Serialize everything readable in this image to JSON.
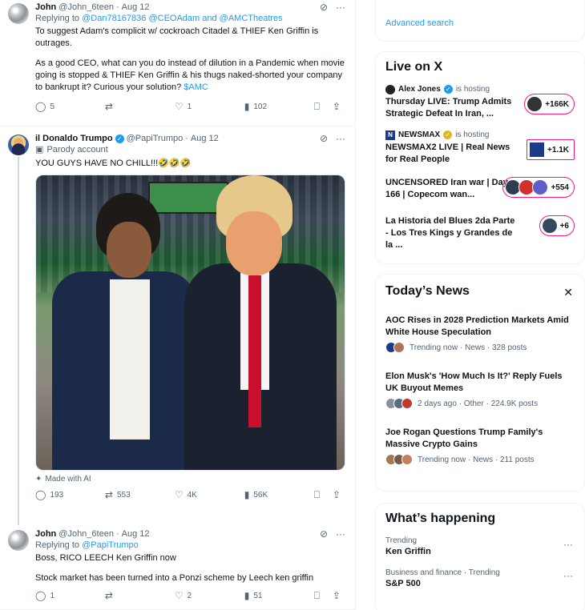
{
  "feed": {
    "tweets": [
      {
        "name": "John",
        "handle": "@John_6teen",
        "dot": "·",
        "date": "Aug 12",
        "replying_prefix": "Replying to",
        "replying_to": "@Dan78167836 @CEOAdam and @AMCTheatres",
        "paragraph1": "To suggest Adam's complicit w/ cockroach Citadel & THIEF Ken Griffin is outrages.",
        "paragraph2": "As a good CEO, what can you do instead of dilution in a Pandemic when movie going is stopped & THIEF Ken Griffin & his thugs naked-shorted your company to bankrupt it? Curious your solution?",
        "cashtag": "$AMC",
        "replies": "5",
        "reposts": "",
        "likes": "1",
        "views": "102"
      },
      {
        "name": "il Donaldo Trumpo",
        "handle": "@PapiTrumpo",
        "dot": "·",
        "date": "Aug 12",
        "parody": "Parody account",
        "text": "YOU GUYS HAVE NO CHILL!!!🤣🤣🤣",
        "made_with_ai": "Made with AI",
        "replies": "193",
        "reposts": "553",
        "likes": "4K",
        "views": "56K"
      },
      {
        "name": "John",
        "handle": "@John_6teen",
        "dot": "·",
        "date": "Aug 12",
        "replying_prefix": "Replying to",
        "replying_to": "@PapiTrumpo",
        "paragraph1": "Boss, RICO LEECH Ken Griffin now",
        "paragraph2": "Stock market has been turned into a Ponzi scheme by Leech ken griffin",
        "replies": "1",
        "reposts": "",
        "likes": "2",
        "views": "51"
      }
    ]
  },
  "sidebar": {
    "advanced_search": "Advanced search",
    "live": {
      "title": "Live on X",
      "hosting": "is hosting",
      "items": [
        {
          "host": "Alex Jones",
          "title": "Thursday LIVE: Trump Admits Strategic Defeat In Iran, ...",
          "count": "+166K"
        },
        {
          "host": "NEWSMAX",
          "title": "NEWSMAX2 LIVE | Real News for Real People",
          "count": "+1.1K"
        },
        {
          "host": "",
          "title": "UNCENSORED Iran war | Day 166 | Copecom wan...",
          "count": "+554"
        },
        {
          "host": "",
          "title": "La Historia del Blues 2da Parte - Los Tres Kings y Grandes de la ...",
          "count": "+6"
        }
      ]
    },
    "news": {
      "title": "Today’s News",
      "close": "✕",
      "items": [
        {
          "title": "AOC Rises in 2028 Prediction Markets Amid White House Speculation",
          "meta": "Trending now · News · 328 posts"
        },
        {
          "title": "Elon Musk's 'How Much Is It?' Reply Fuels UK Buyout Memes",
          "meta": "2 days ago · Other · 224.9K posts"
        },
        {
          "title": "Joe Rogan Questions Trump Family's Massive Crypto Gains",
          "meta": "Trending now · News · 211 posts"
        }
      ]
    },
    "happening": {
      "title": "What’s happening",
      "items": [
        {
          "category": "Trending",
          "name": "Ken Griffin"
        },
        {
          "category": "Business and finance · Trending",
          "name": "S&P 500"
        }
      ]
    }
  },
  "colors": {
    "accent": "#1d9bf0",
    "live_pink": "#f91880",
    "verified_gold": "#e2b719"
  },
  "icons": [
    "grok-icon",
    "more-icon",
    "reply-icon",
    "repost-icon",
    "like-icon",
    "views-icon",
    "bookmark-icon",
    "share-icon",
    "parody-icon",
    "ai-sparkle-icon",
    "close-icon"
  ]
}
